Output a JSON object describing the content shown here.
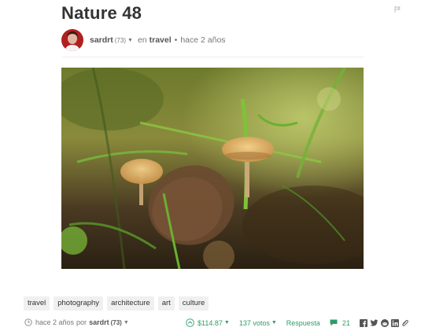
{
  "post": {
    "title": "Nature 48",
    "author": "sardrt",
    "reputation": "(73)",
    "category_prefix": "en",
    "category": "travel",
    "time": "hace 2 años"
  },
  "tags": [
    "travel",
    "photography",
    "architecture",
    "art",
    "culture"
  ],
  "footer": {
    "time": "hace 2 años",
    "by": "por",
    "author": "sardrt",
    "reputation": "(73)",
    "payout": "$114.87",
    "votes": "137 votos",
    "reply": "Respuesta",
    "comments": "21"
  },
  "icons": [
    "flag-icon",
    "clock-icon",
    "upvote-icon",
    "comment-icon",
    "facebook-icon",
    "twitter-icon",
    "reddit-icon",
    "linkedin-icon",
    "link-icon"
  ],
  "colors": {
    "accent": "#2e9c6a",
    "tag_bg": "#f0f0f0",
    "title": "#333333"
  }
}
